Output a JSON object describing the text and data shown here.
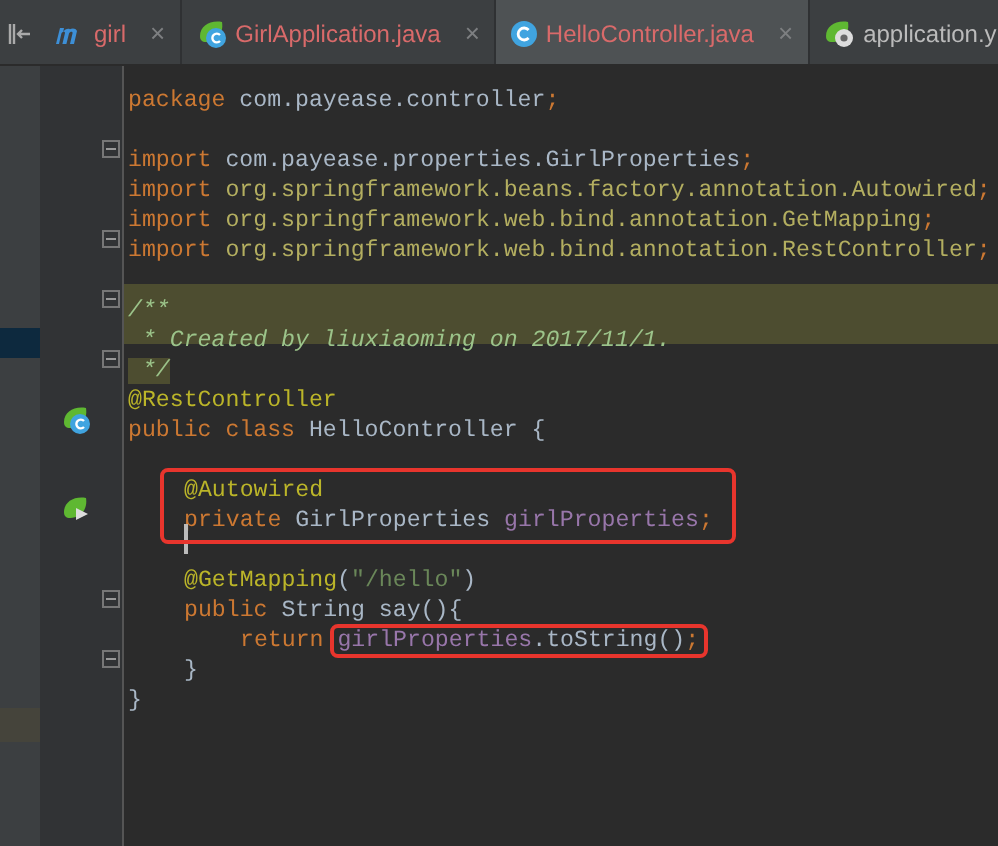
{
  "tabs": [
    {
      "label": "girl",
      "kind": "maven",
      "selected": false,
      "close": "×"
    },
    {
      "label": "GirlApplication.java",
      "kind": "spring-class",
      "selected": false,
      "close": "×"
    },
    {
      "label": "HelloController.java",
      "kind": "class",
      "selected": true,
      "close": "×"
    },
    {
      "label": "application.y",
      "kind": "spring-config",
      "selected": false
    }
  ],
  "code": {
    "lines": [
      {
        "kind": "code",
        "tokens": [
          {
            "text": "package",
            "kind": "keyword"
          },
          {
            "text": " com.payease.controller",
            "kind": "plain"
          },
          {
            "text": ";",
            "kind": "keyword"
          }
        ]
      },
      {
        "kind": "blank"
      },
      {
        "kind": "code",
        "fold": true,
        "tokens": [
          {
            "text": "import",
            "kind": "keyword"
          },
          {
            "text": " com.payease.properties.GirlProperties",
            "kind": "plain"
          },
          {
            "text": ";",
            "kind": "keyword"
          }
        ]
      },
      {
        "kind": "code",
        "tokens": [
          {
            "text": "import",
            "kind": "keyword"
          },
          {
            "text": " org.springframework.beans.factory.annotation.Autowired",
            "kind": "path"
          },
          {
            "text": ";",
            "kind": "keyword"
          }
        ]
      },
      {
        "kind": "code",
        "tokens": [
          {
            "text": "import",
            "kind": "keyword"
          },
          {
            "text": " org.springframework.web.bind.annotation.GetMapping",
            "kind": "path"
          },
          {
            "text": ";",
            "kind": "keyword"
          }
        ]
      },
      {
        "kind": "code",
        "fold": true,
        "tokens": [
          {
            "text": "import",
            "kind": "keyword"
          },
          {
            "text": " org.springframework.web.bind.annotation.RestController",
            "kind": "path"
          },
          {
            "text": ";",
            "kind": "keyword"
          }
        ]
      },
      {
        "kind": "blank"
      },
      {
        "kind": "code",
        "fold": true,
        "highlighted": true,
        "tokens": [
          {
            "text": "/**",
            "kind": "doc"
          }
        ]
      },
      {
        "kind": "code",
        "highlighted": true,
        "tokens": [
          {
            "text": " * Created by liuxiaoming on 2017/11/1.",
            "kind": "doc"
          }
        ]
      },
      {
        "kind": "code",
        "fold": true,
        "tokens": [
          {
            "text": " */",
            "kind": "doc",
            "highlighted": true
          }
        ]
      },
      {
        "kind": "code",
        "tokens": [
          {
            "text": "@RestController",
            "kind": "annotation"
          }
        ]
      },
      {
        "kind": "code",
        "gutter_marker": {
          "kind": "spring-class"
        },
        "tokens": [
          {
            "text": "public",
            "kind": "keyword"
          },
          {
            "text": " class",
            "kind": "keyword"
          },
          {
            "text": " HelloController {",
            "kind": "plain"
          }
        ],
        "children": [
          {
            "kind": "blank"
          },
          {
            "kind": "code",
            "boxed": true,
            "tokens": [
              {
                "text": "@Autowired",
                "kind": "annotation"
              }
            ]
          },
          {
            "kind": "code",
            "boxed": true,
            "gutter_marker": {
              "kind": "spring-bean"
            },
            "tokens": [
              {
                "text": "private",
                "kind": "keyword"
              },
              {
                "text": " GirlProperties ",
                "kind": "plain"
              },
              {
                "text": "girlProperties",
                "kind": "field"
              },
              {
                "text": ";",
                "kind": "keyword"
              }
            ]
          },
          {
            "kind": "blank",
            "caret": true
          },
          {
            "kind": "code",
            "tokens": [
              {
                "text": "@GetMapping",
                "kind": "annotation"
              },
              {
                "text": "(",
                "kind": "plain"
              },
              {
                "text": "\"/hello\"",
                "kind": "string"
              },
              {
                "text": ")",
                "kind": "plain"
              }
            ]
          },
          {
            "kind": "code",
            "fold": true,
            "tokens": [
              {
                "text": "public",
                "kind": "keyword"
              },
              {
                "text": " String say(){",
                "kind": "plain"
              }
            ],
            "children": [
              {
                "kind": "code",
                "tokens": [
                  {
                    "text": "return ",
                    "kind": "keyword"
                  },
                  {
                    "text": "girlProperties",
                    "kind": "field",
                    "boxed": true
                  },
                  {
                    "text": ".toString()",
                    "kind": "plain",
                    "boxed": true
                  },
                  {
                    "text": ";",
                    "kind": "keyword",
                    "boxed": true
                  }
                ]
              }
            ]
          },
          {
            "kind": "code",
            "fold": true,
            "tokens": [
              {
                "text": "}",
                "kind": "plain"
              }
            ]
          }
        ]
      },
      {
        "kind": "code",
        "tokens": [
          {
            "text": "}",
            "kind": "plain"
          }
        ]
      }
    ]
  }
}
